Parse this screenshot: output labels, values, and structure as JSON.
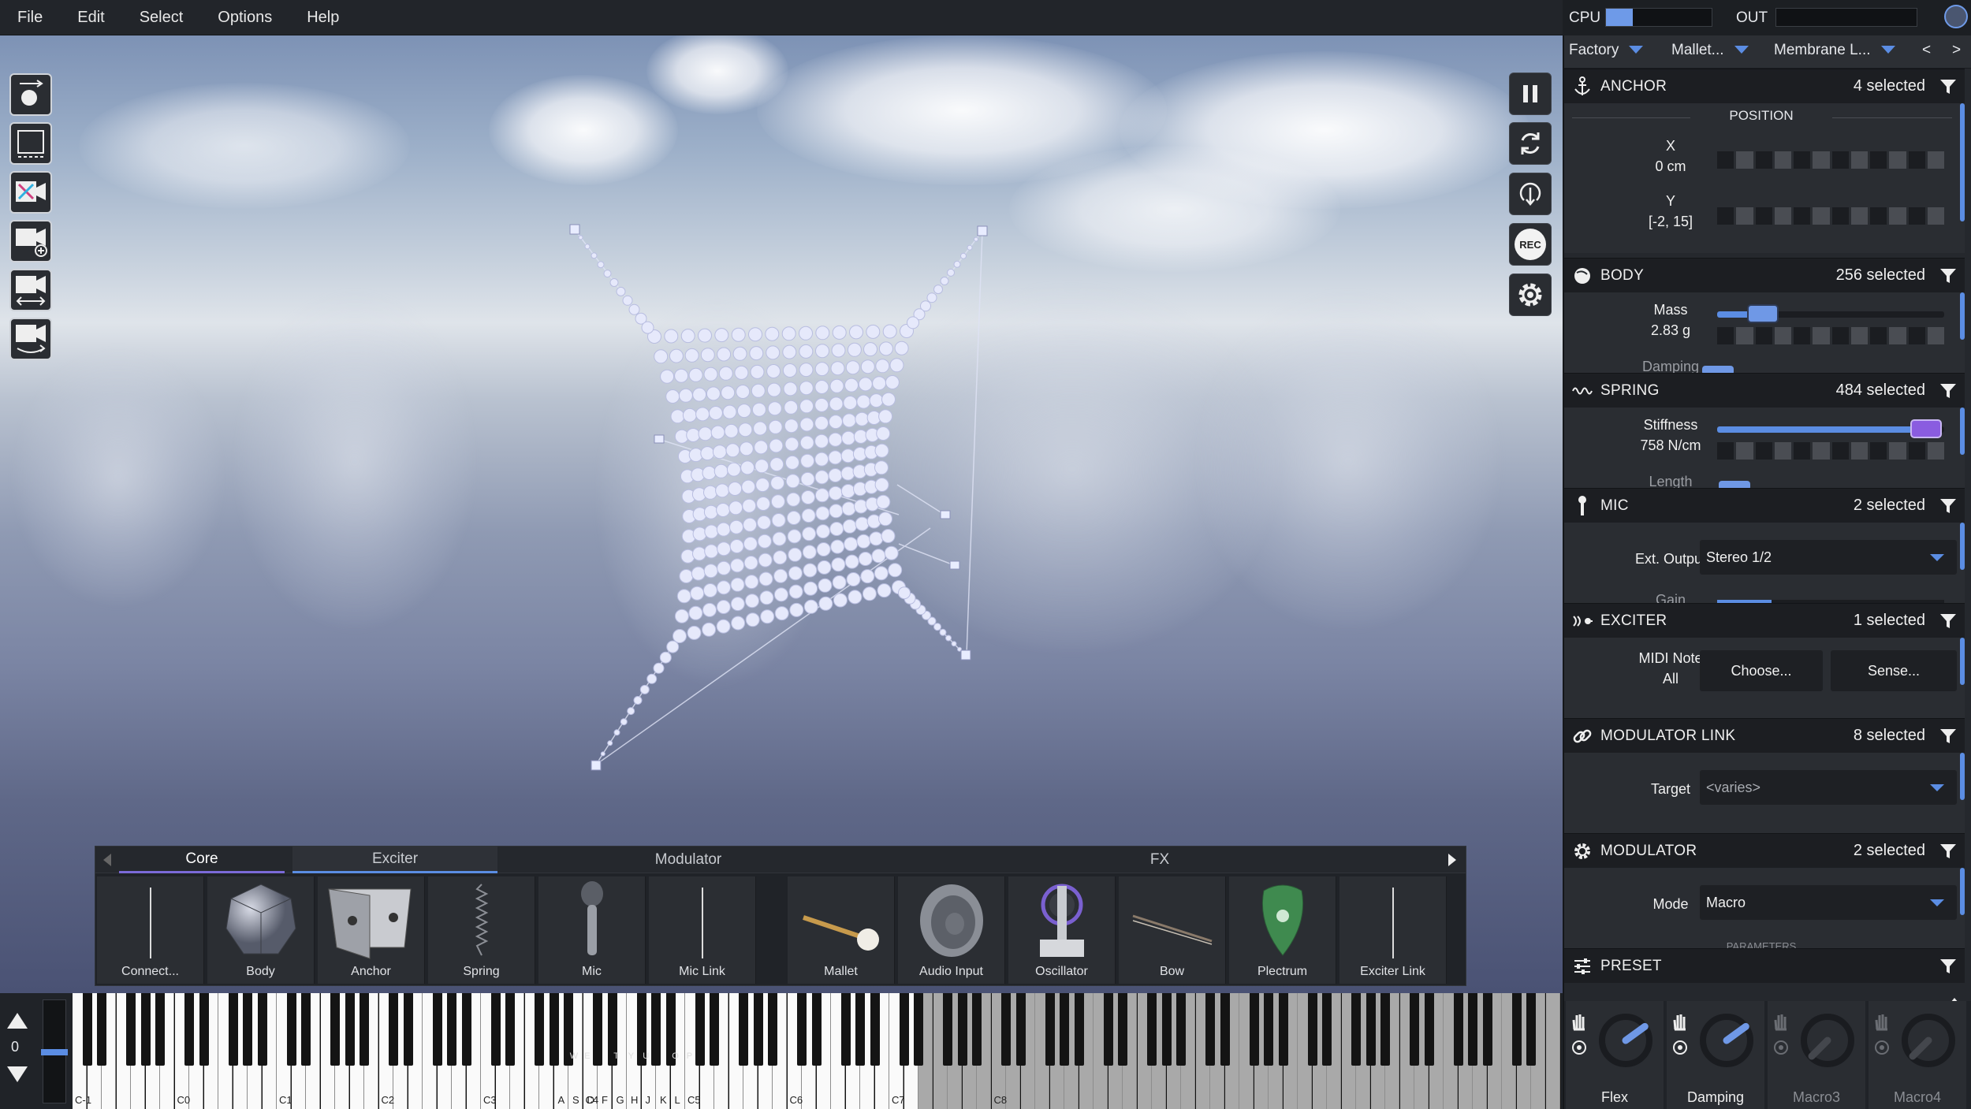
{
  "menu": [
    "File",
    "Edit",
    "Select",
    "Options",
    "Help"
  ],
  "meters": {
    "cpu_label": "CPU",
    "out_label": "OUT",
    "cpu_level": 0.25
  },
  "presets": {
    "bank": "Factory",
    "category": "Mallet...",
    "preset": "Membrane L...",
    "prev": "<",
    "next": ">"
  },
  "sections": {
    "anchor": {
      "title": "ANCHOR",
      "count": "4 selected",
      "position_header": "POSITION",
      "x_label": "X",
      "x_value": "0 cm",
      "y_label": "Y",
      "y_value": "[-2, 15]"
    },
    "body": {
      "title": "BODY",
      "count": "256 selected",
      "mass_label": "Mass",
      "mass_value": "2.83 g",
      "mass_level": 0.2,
      "damping_label": "Damping"
    },
    "spring": {
      "title": "SPRING",
      "count": "484 selected",
      "stiffness_label": "Stiffness",
      "stiffness_value": "758 N/cm",
      "stiffness_level": 0.92,
      "length_label": "Length"
    },
    "mic": {
      "title": "MIC",
      "count": "2 selected",
      "ext_output_label": "Ext. Output",
      "ext_output_value": "Stereo 1/2",
      "gain_label": "Gain"
    },
    "exciter": {
      "title": "EXCITER",
      "count": "1 selected",
      "midi_note_label": "MIDI Note",
      "midi_note_value": "All",
      "choose_label": "Choose...",
      "sense_label": "Sense..."
    },
    "modlink": {
      "title": "MODULATOR LINK",
      "count": "8 selected",
      "target_label": "Target",
      "target_value": "<varies>"
    },
    "modulator": {
      "title": "MODULATOR",
      "count": "2 selected",
      "mode_label": "Mode",
      "mode_value": "Macro",
      "params_label": "PARAMETERS"
    },
    "preset": {
      "title": "PRESET"
    }
  },
  "macros": [
    {
      "name": "Flex",
      "value": 0.7
    },
    {
      "name": "Damping",
      "value": 0.7
    },
    {
      "name": "Macro3",
      "value": 0.0
    },
    {
      "name": "Macro4",
      "value": 0.0
    }
  ],
  "palette": {
    "tabs": [
      "Core",
      "Exciter",
      "Modulator",
      "FX"
    ],
    "items": [
      "Connect...",
      "Body",
      "Anchor",
      "Spring",
      "Mic",
      "Mic Link",
      "Mallet",
      "Audio Input",
      "Oscillator",
      "Bow",
      "Plectrum",
      "Exciter Link"
    ]
  },
  "keyboard": {
    "octave_value": "0",
    "octave_labels": [
      "C-1",
      "C0",
      "C1",
      "C2",
      "C3",
      "C4",
      "C5",
      "C6",
      "C7",
      "C8"
    ],
    "computer_keys_white": [
      "A",
      "S",
      "D",
      "F",
      "G",
      "H",
      "J",
      "K",
      "L"
    ],
    "computer_keys_black": [
      "W",
      "E",
      "T",
      "Y",
      "U",
      "O",
      "P"
    ]
  },
  "transport": {
    "rec_label": "REC"
  }
}
